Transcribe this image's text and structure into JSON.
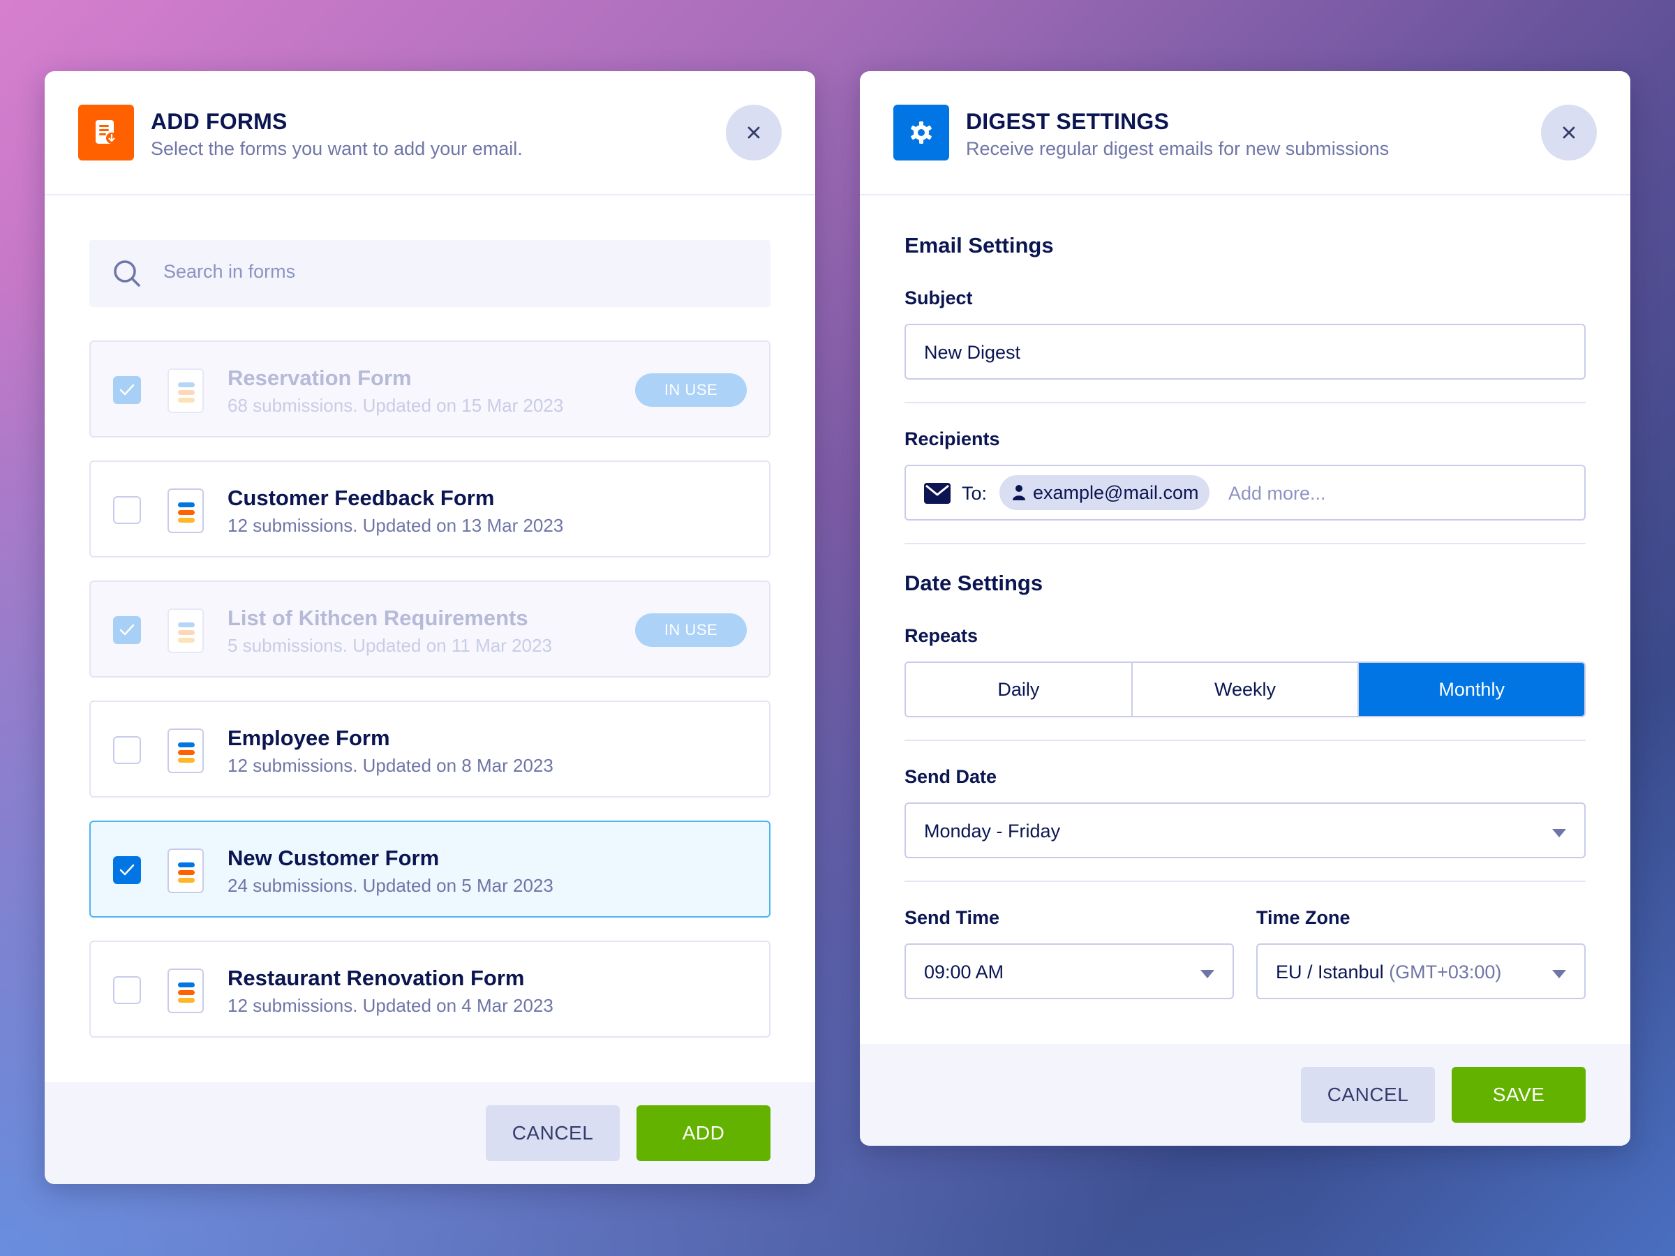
{
  "add_forms": {
    "title": "ADD FORMS",
    "subtitle": "Select the forms you want to add your email.",
    "icon": "form-import-icon",
    "icon_color": "#ff6100",
    "search": {
      "placeholder": "Search in forms",
      "value": ""
    },
    "forms": [
      {
        "name": "Reservation Form",
        "meta": "68 submissions. Updated on 15 Mar 2023",
        "checked": true,
        "disabled": true,
        "badge": "IN USE"
      },
      {
        "name": "Customer Feedback Form",
        "meta": "12 submissions. Updated on 13 Mar 2023",
        "checked": false,
        "disabled": false,
        "badge": ""
      },
      {
        "name": "List of Kithcen Requirements",
        "meta": "5 submissions. Updated on 11 Mar 2023",
        "checked": true,
        "disabled": true,
        "badge": "IN USE"
      },
      {
        "name": "Employee Form",
        "meta": "12 submissions. Updated on 8 Mar 2023",
        "checked": false,
        "disabled": false,
        "badge": ""
      },
      {
        "name": "New Customer Form",
        "meta": "24 submissions. Updated on 5 Mar 2023",
        "checked": true,
        "disabled": false,
        "badge": ""
      },
      {
        "name": "Restaurant Renovation Form",
        "meta": "12 submissions. Updated on 4 Mar 2023",
        "checked": false,
        "disabled": false,
        "badge": ""
      }
    ],
    "cancel_label": "CANCEL",
    "add_label": "ADD"
  },
  "digest": {
    "title": "DIGEST SETTINGS",
    "subtitle": "Receive regular digest emails for new submissions",
    "icon": "gear-icon",
    "icon_color": "#0075e3",
    "email_settings_title": "Email Settings",
    "subject_label": "Subject",
    "subject_value": "New Digest",
    "recipients_label": "Recipients",
    "to_label": "To:",
    "recipient_chip": "example@mail.com",
    "add_more_placeholder": "Add more...",
    "date_settings_title": "Date Settings",
    "repeats_label": "Repeats",
    "repeat_options": [
      "Daily",
      "Weekly",
      "Monthly"
    ],
    "repeat_selected": "Monthly",
    "send_date_label": "Send Date",
    "send_date_value": "Monday - Friday",
    "send_time_label": "Send Time",
    "send_time_value": "09:00 AM",
    "time_zone_label": "Time Zone",
    "time_zone_value": "EU / Istanbul",
    "time_zone_offset": "(GMT+03:00)",
    "cancel_label": "CANCEL",
    "save_label": "SAVE"
  },
  "colors": {
    "primary_blue": "#0075e3",
    "success_green": "#64b200",
    "navy_text": "#0a1551",
    "muted_text": "#6f76a7"
  }
}
